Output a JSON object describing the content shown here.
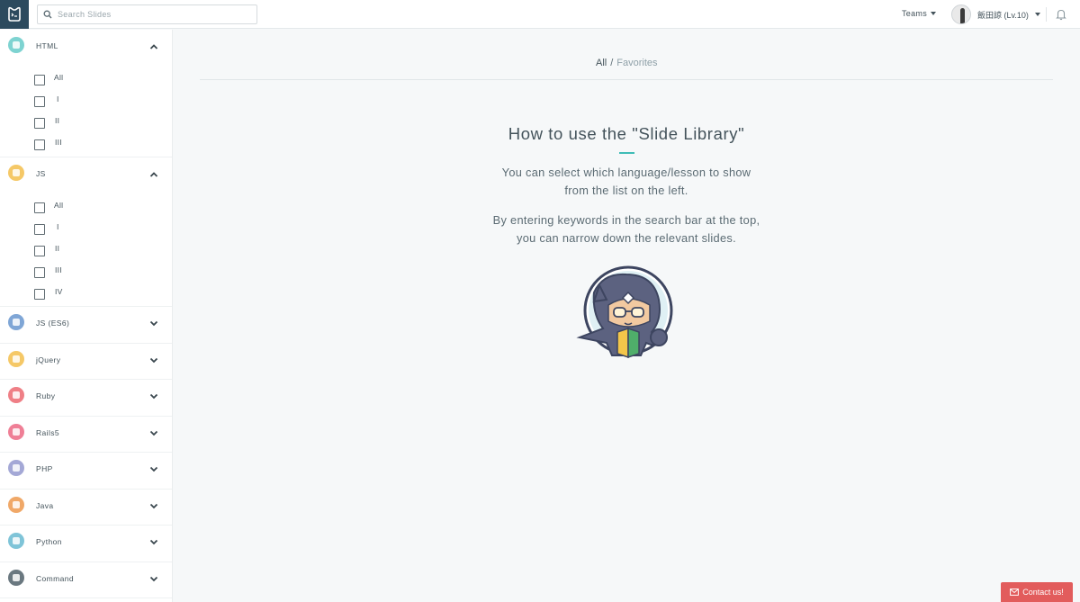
{
  "search": {
    "placeholder": "Search Slides"
  },
  "header": {
    "teams_label": "Teams",
    "user_label": "飯田諒 (Lv.10)"
  },
  "sidebar": {
    "categories": [
      {
        "label": "HTML",
        "expanded": true,
        "icon_color": "#7ed3d1",
        "options": [
          "All",
          "I",
          "II",
          "III"
        ]
      },
      {
        "label": "JS",
        "expanded": true,
        "icon_color": "#f5c867",
        "options": [
          "All",
          "I",
          "II",
          "III",
          "IV"
        ]
      },
      {
        "label": "JS (ES6)",
        "expanded": false,
        "icon_color": "#7fa6d6"
      },
      {
        "label": "jQuery",
        "expanded": false,
        "icon_color": "#f5c867"
      },
      {
        "label": "Ruby",
        "expanded": false,
        "icon_color": "#ef7f86"
      },
      {
        "label": "Rails5",
        "expanded": false,
        "icon_color": "#ef7f96"
      },
      {
        "label": "PHP",
        "expanded": false,
        "icon_color": "#a4a8d6"
      },
      {
        "label": "Java",
        "expanded": false,
        "icon_color": "#f0a868"
      },
      {
        "label": "Python",
        "expanded": false,
        "icon_color": "#7fc4d8"
      },
      {
        "label": "Command",
        "expanded": false,
        "icon_color": "#6a7880"
      }
    ]
  },
  "breadcrumb": {
    "all": "All",
    "separator": "/",
    "favorites": "Favorites"
  },
  "main": {
    "title": "How to use the \"Slide Library\"",
    "para1_line1": "You can select which language/lesson to show",
    "para1_line2": "from the list on the left.",
    "para2_line1": "By entering keywords in the search bar at the top,",
    "para2_line2": "you can narrow down the relevant slides."
  },
  "contact": {
    "label": "Contact us!"
  },
  "colors": {
    "accent": "#3fbcb6",
    "header_logo_bg": "#2c4a5e",
    "contact_bg": "#e25c5c"
  }
}
